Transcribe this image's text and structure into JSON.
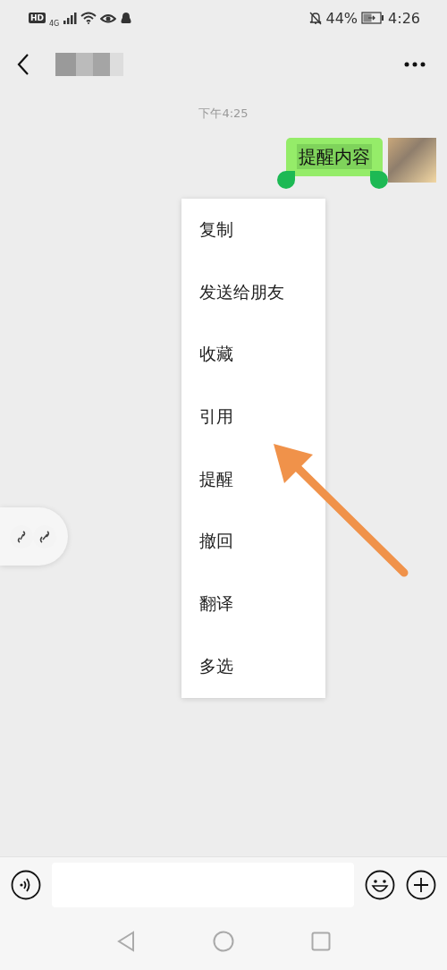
{
  "status_bar": {
    "hd": "HD",
    "network": "4G",
    "battery": "44%",
    "time": "4:26"
  },
  "chat": {
    "timestamp": "下午4:25",
    "messages": [
      {
        "text": "提醒内容",
        "selected": true
      }
    ]
  },
  "context_menu": {
    "items": [
      {
        "label": "复制"
      },
      {
        "label": "发送给朋友"
      },
      {
        "label": "收藏"
      },
      {
        "label": "引用"
      },
      {
        "label": "提醒"
      },
      {
        "label": "撤回"
      },
      {
        "label": "翻译"
      },
      {
        "label": "多选"
      }
    ]
  }
}
